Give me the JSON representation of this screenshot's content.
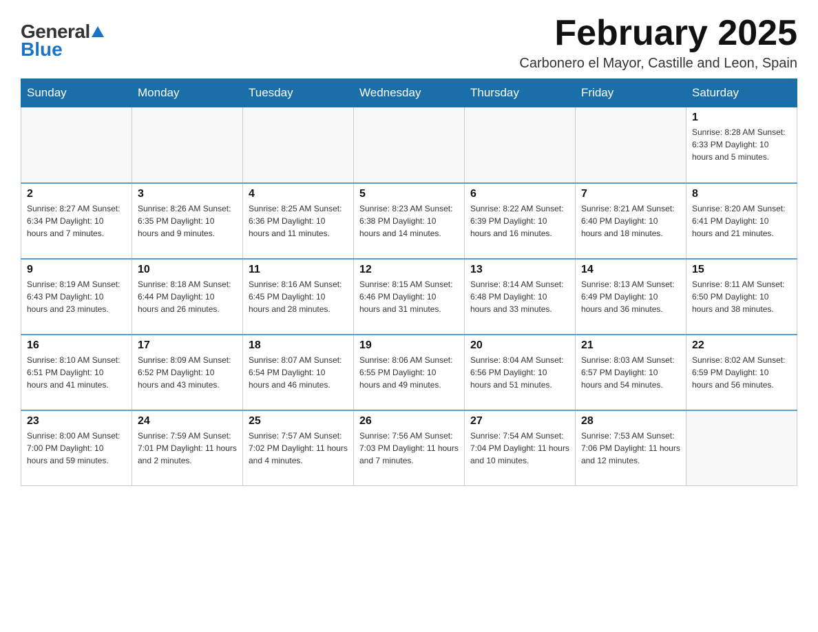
{
  "logo": {
    "general": "General",
    "blue": "Blue"
  },
  "title": "February 2025",
  "subtitle": "Carbonero el Mayor, Castille and Leon, Spain",
  "days_of_week": [
    "Sunday",
    "Monday",
    "Tuesday",
    "Wednesday",
    "Thursday",
    "Friday",
    "Saturday"
  ],
  "weeks": [
    [
      {
        "day": "",
        "info": ""
      },
      {
        "day": "",
        "info": ""
      },
      {
        "day": "",
        "info": ""
      },
      {
        "day": "",
        "info": ""
      },
      {
        "day": "",
        "info": ""
      },
      {
        "day": "",
        "info": ""
      },
      {
        "day": "1",
        "info": "Sunrise: 8:28 AM\nSunset: 6:33 PM\nDaylight: 10 hours\nand 5 minutes."
      }
    ],
    [
      {
        "day": "2",
        "info": "Sunrise: 8:27 AM\nSunset: 6:34 PM\nDaylight: 10 hours\nand 7 minutes."
      },
      {
        "day": "3",
        "info": "Sunrise: 8:26 AM\nSunset: 6:35 PM\nDaylight: 10 hours\nand 9 minutes."
      },
      {
        "day": "4",
        "info": "Sunrise: 8:25 AM\nSunset: 6:36 PM\nDaylight: 10 hours\nand 11 minutes."
      },
      {
        "day": "5",
        "info": "Sunrise: 8:23 AM\nSunset: 6:38 PM\nDaylight: 10 hours\nand 14 minutes."
      },
      {
        "day": "6",
        "info": "Sunrise: 8:22 AM\nSunset: 6:39 PM\nDaylight: 10 hours\nand 16 minutes."
      },
      {
        "day": "7",
        "info": "Sunrise: 8:21 AM\nSunset: 6:40 PM\nDaylight: 10 hours\nand 18 minutes."
      },
      {
        "day": "8",
        "info": "Sunrise: 8:20 AM\nSunset: 6:41 PM\nDaylight: 10 hours\nand 21 minutes."
      }
    ],
    [
      {
        "day": "9",
        "info": "Sunrise: 8:19 AM\nSunset: 6:43 PM\nDaylight: 10 hours\nand 23 minutes."
      },
      {
        "day": "10",
        "info": "Sunrise: 8:18 AM\nSunset: 6:44 PM\nDaylight: 10 hours\nand 26 minutes."
      },
      {
        "day": "11",
        "info": "Sunrise: 8:16 AM\nSunset: 6:45 PM\nDaylight: 10 hours\nand 28 minutes."
      },
      {
        "day": "12",
        "info": "Sunrise: 8:15 AM\nSunset: 6:46 PM\nDaylight: 10 hours\nand 31 minutes."
      },
      {
        "day": "13",
        "info": "Sunrise: 8:14 AM\nSunset: 6:48 PM\nDaylight: 10 hours\nand 33 minutes."
      },
      {
        "day": "14",
        "info": "Sunrise: 8:13 AM\nSunset: 6:49 PM\nDaylight: 10 hours\nand 36 minutes."
      },
      {
        "day": "15",
        "info": "Sunrise: 8:11 AM\nSunset: 6:50 PM\nDaylight: 10 hours\nand 38 minutes."
      }
    ],
    [
      {
        "day": "16",
        "info": "Sunrise: 8:10 AM\nSunset: 6:51 PM\nDaylight: 10 hours\nand 41 minutes."
      },
      {
        "day": "17",
        "info": "Sunrise: 8:09 AM\nSunset: 6:52 PM\nDaylight: 10 hours\nand 43 minutes."
      },
      {
        "day": "18",
        "info": "Sunrise: 8:07 AM\nSunset: 6:54 PM\nDaylight: 10 hours\nand 46 minutes."
      },
      {
        "day": "19",
        "info": "Sunrise: 8:06 AM\nSunset: 6:55 PM\nDaylight: 10 hours\nand 49 minutes."
      },
      {
        "day": "20",
        "info": "Sunrise: 8:04 AM\nSunset: 6:56 PM\nDaylight: 10 hours\nand 51 minutes."
      },
      {
        "day": "21",
        "info": "Sunrise: 8:03 AM\nSunset: 6:57 PM\nDaylight: 10 hours\nand 54 minutes."
      },
      {
        "day": "22",
        "info": "Sunrise: 8:02 AM\nSunset: 6:59 PM\nDaylight: 10 hours\nand 56 minutes."
      }
    ],
    [
      {
        "day": "23",
        "info": "Sunrise: 8:00 AM\nSunset: 7:00 PM\nDaylight: 10 hours\nand 59 minutes."
      },
      {
        "day": "24",
        "info": "Sunrise: 7:59 AM\nSunset: 7:01 PM\nDaylight: 11 hours\nand 2 minutes."
      },
      {
        "day": "25",
        "info": "Sunrise: 7:57 AM\nSunset: 7:02 PM\nDaylight: 11 hours\nand 4 minutes."
      },
      {
        "day": "26",
        "info": "Sunrise: 7:56 AM\nSunset: 7:03 PM\nDaylight: 11 hours\nand 7 minutes."
      },
      {
        "day": "27",
        "info": "Sunrise: 7:54 AM\nSunset: 7:04 PM\nDaylight: 11 hours\nand 10 minutes."
      },
      {
        "day": "28",
        "info": "Sunrise: 7:53 AM\nSunset: 7:06 PM\nDaylight: 11 hours\nand 12 minutes."
      },
      {
        "day": "",
        "info": ""
      }
    ]
  ]
}
